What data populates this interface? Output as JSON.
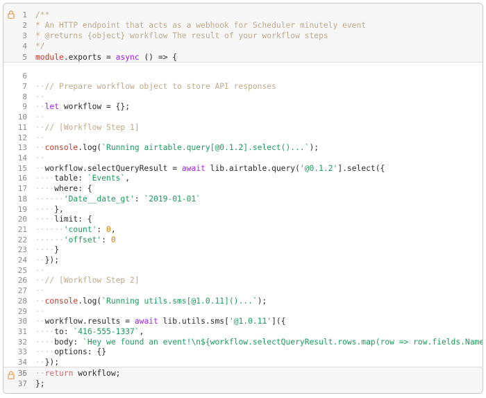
{
  "editor": {
    "lines": [
      {
        "n": "1",
        "t": [
          [
            "comment",
            "/**"
          ]
        ]
      },
      {
        "n": "2",
        "t": [
          [
            "comment",
            "* An HTTP endpoint that acts as a webhook for Scheduler minutely event"
          ]
        ]
      },
      {
        "n": "3",
        "t": [
          [
            "comment",
            "* @returns {object} workflow The result of your workflow steps"
          ]
        ]
      },
      {
        "n": "4",
        "t": [
          [
            "comment",
            "*/"
          ]
        ]
      },
      {
        "n": "5",
        "t": [
          [
            "func",
            "module"
          ],
          [
            "plain",
            ".exports = "
          ],
          [
            "keyword",
            "async"
          ],
          [
            "plain",
            " () => {"
          ]
        ]
      },
      {
        "n": "6",
        "t": []
      },
      {
        "n": "7",
        "t": [
          [
            "ws",
            "··"
          ],
          [
            "comment",
            "// Prepare workflow object to store API responses"
          ]
        ]
      },
      {
        "n": "8",
        "t": [
          [
            "ws",
            "··"
          ]
        ]
      },
      {
        "n": "9",
        "t": [
          [
            "ws",
            "··"
          ],
          [
            "keyword",
            "let"
          ],
          [
            "plain",
            " workflow = {};"
          ]
        ]
      },
      {
        "n": "10",
        "t": [
          [
            "ws",
            "··"
          ]
        ]
      },
      {
        "n": "11",
        "t": [
          [
            "ws",
            "··"
          ],
          [
            "comment",
            "// [Workflow Step 1]"
          ]
        ]
      },
      {
        "n": "12",
        "t": [
          [
            "ws",
            "··"
          ]
        ]
      },
      {
        "n": "13",
        "t": [
          [
            "ws",
            "··"
          ],
          [
            "func",
            "console"
          ],
          [
            "plain",
            ".log("
          ],
          [
            "string",
            "`Running airtable.query[@0.1.2].select()...`"
          ],
          [
            "plain",
            ");"
          ]
        ]
      },
      {
        "n": "14",
        "t": [
          [
            "ws",
            "··"
          ]
        ]
      },
      {
        "n": "15",
        "t": [
          [
            "ws",
            "··"
          ],
          [
            "plain",
            "workflow.selectQueryResult = "
          ],
          [
            "keyword",
            "await"
          ],
          [
            "plain",
            " lib.airtable.query("
          ],
          [
            "string",
            "'@0.1.2'"
          ],
          [
            "plain",
            "].select({"
          ]
        ]
      },
      {
        "n": "16",
        "t": [
          [
            "ws",
            "····"
          ],
          [
            "plain",
            "table: "
          ],
          [
            "string",
            "`Events`"
          ],
          [
            "plain",
            ","
          ]
        ]
      },
      {
        "n": "17",
        "t": [
          [
            "ws",
            "····"
          ],
          [
            "plain",
            "where: {"
          ]
        ]
      },
      {
        "n": "18",
        "t": [
          [
            "ws",
            "······"
          ],
          [
            "string",
            "'Date__date_gt'"
          ],
          [
            "plain",
            ": "
          ],
          [
            "string",
            "`2019-01-01`"
          ]
        ]
      },
      {
        "n": "19",
        "t": [
          [
            "ws",
            "····"
          ],
          [
            "plain",
            "},"
          ]
        ]
      },
      {
        "n": "20",
        "t": [
          [
            "ws",
            "····"
          ],
          [
            "plain",
            "limit: {"
          ]
        ]
      },
      {
        "n": "21",
        "t": [
          [
            "ws",
            "······"
          ],
          [
            "string",
            "'count'"
          ],
          [
            "plain",
            ": "
          ],
          [
            "number",
            "0"
          ],
          [
            "plain",
            ","
          ]
        ]
      },
      {
        "n": "22",
        "t": [
          [
            "ws",
            "······"
          ],
          [
            "string",
            "'offset'"
          ],
          [
            "plain",
            ": "
          ],
          [
            "number",
            "0"
          ]
        ]
      },
      {
        "n": "23",
        "t": [
          [
            "ws",
            "····"
          ],
          [
            "plain",
            "}"
          ]
        ]
      },
      {
        "n": "24",
        "t": [
          [
            "ws",
            "··"
          ],
          [
            "plain",
            "});"
          ]
        ]
      },
      {
        "n": "25",
        "t": [
          [
            "ws",
            "··"
          ]
        ]
      },
      {
        "n": "26",
        "t": [
          [
            "ws",
            "··"
          ],
          [
            "comment",
            "// [Workflow Step 2]"
          ]
        ]
      },
      {
        "n": "27",
        "t": [
          [
            "ws",
            "··"
          ]
        ]
      },
      {
        "n": "28",
        "t": [
          [
            "ws",
            "··"
          ],
          [
            "func",
            "console"
          ],
          [
            "plain",
            ".log("
          ],
          [
            "string",
            "`Running utils.sms[@1.0.11]()...`"
          ],
          [
            "plain",
            ");"
          ]
        ]
      },
      {
        "n": "29",
        "t": [
          [
            "ws",
            "··"
          ]
        ]
      },
      {
        "n": "30",
        "t": [
          [
            "ws",
            "··"
          ],
          [
            "plain",
            "workflow.results = "
          ],
          [
            "keyword",
            "await"
          ],
          [
            "plain",
            " lib.utils.sms["
          ],
          [
            "string",
            "'@1.0.11'"
          ],
          [
            "plain",
            "]({"
          ]
        ]
      },
      {
        "n": "31",
        "t": [
          [
            "ws",
            "····"
          ],
          [
            "plain",
            "to: "
          ],
          [
            "string",
            "`416-555-1337`"
          ],
          [
            "plain",
            ","
          ]
        ]
      },
      {
        "n": "32",
        "t": [
          [
            "ws",
            "····"
          ],
          [
            "plain",
            "body: "
          ],
          [
            "string",
            "`Hey we found an event!\\n${workflow.selectQueryResult.rows.map(row => row.fields.Name +"
          ]
        ]
      },
      {
        "n": "33",
        "t": [
          [
            "ws",
            "····"
          ],
          [
            "plain",
            "options: {}"
          ]
        ]
      },
      {
        "n": "34",
        "t": [
          [
            "ws",
            "··"
          ],
          [
            "plain",
            "});"
          ]
        ]
      },
      {
        "n": "35",
        "t": []
      },
      {
        "n": "36",
        "t": [
          [
            "ws",
            "··"
          ],
          [
            "return",
            "return"
          ],
          [
            "plain",
            " workflow;"
          ]
        ]
      },
      {
        "n": "37",
        "t": [
          [
            "plain",
            "};"
          ]
        ]
      }
    ]
  }
}
